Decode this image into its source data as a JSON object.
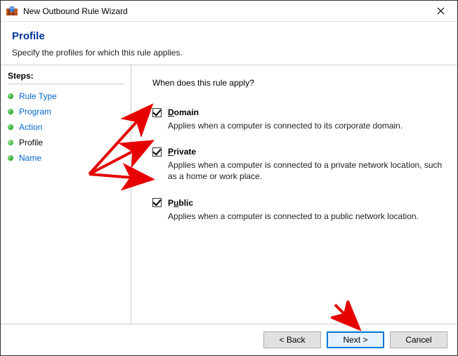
{
  "window": {
    "title": "New Outbound Rule Wizard"
  },
  "header": {
    "title": "Profile",
    "subtitle": "Specify the profiles for which this rule applies."
  },
  "sidebar": {
    "steps_label": "Steps:",
    "items": [
      {
        "label": "Rule Type",
        "is_current": false
      },
      {
        "label": "Program",
        "is_current": false
      },
      {
        "label": "Action",
        "is_current": false
      },
      {
        "label": "Profile",
        "is_current": true
      },
      {
        "label": "Name",
        "is_current": false
      }
    ]
  },
  "content": {
    "question": "When does this rule apply?",
    "options": [
      {
        "key": "domain",
        "mnemonic": "D",
        "rest": "omain",
        "checked": true,
        "description": "Applies when a computer is connected to its corporate domain."
      },
      {
        "key": "private",
        "mnemonic": "P",
        "rest": "rivate",
        "checked": true,
        "description": "Applies when a computer is connected to a private network location, such as a home or work place."
      },
      {
        "key": "public",
        "mnemonic": "u",
        "prefix": "P",
        "rest": "blic",
        "checked": true,
        "description": "Applies when a computer is connected to a public network location."
      }
    ]
  },
  "footer": {
    "back": "< Back",
    "next": "Next >",
    "cancel": "Cancel"
  }
}
